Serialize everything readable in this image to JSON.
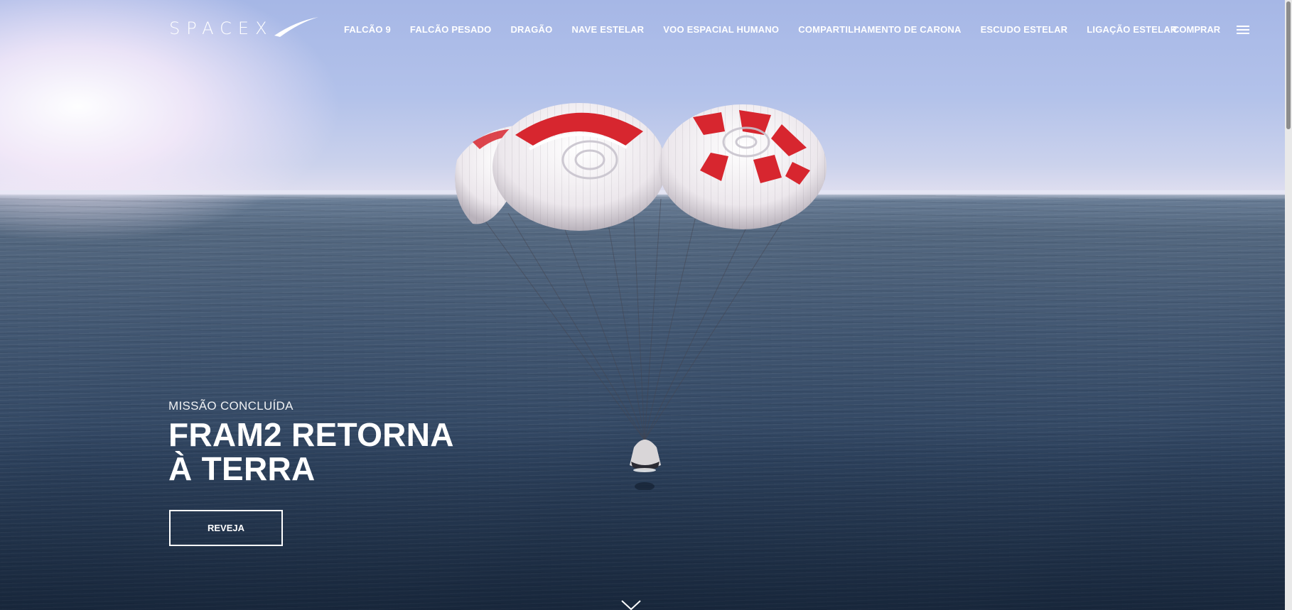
{
  "brand": {
    "logo_text": "SPACEX"
  },
  "nav": {
    "items": [
      {
        "label": "FALCÃO 9"
      },
      {
        "label": "FALCÃO PESADO"
      },
      {
        "label": "DRAGÃO"
      },
      {
        "label": "NAVE ESTELAR"
      },
      {
        "label": "VOO ESPACIAL HUMANO"
      },
      {
        "label": "COMPARTILHAMENTO DE CARONA"
      },
      {
        "label": "ESCUDO ESTELAR"
      },
      {
        "label": "LIGAÇÃO ESTELAR"
      }
    ],
    "shop_label": "COMPRAR",
    "menu_icon": "hamburger-menu-icon"
  },
  "hero": {
    "kicker": "MISSÃO CONCLUÍDA",
    "title": "FRAM2 RETORNA À TERRA",
    "button_label": "REVEJA",
    "scroll_icon": "chevron-down-icon"
  },
  "colors": {
    "text": "#ffffff",
    "canopy_red": "#d7262f",
    "canopy_white": "#f4f1f3",
    "ocean": "#3b4f6a",
    "sky": "#a6b7e6"
  }
}
